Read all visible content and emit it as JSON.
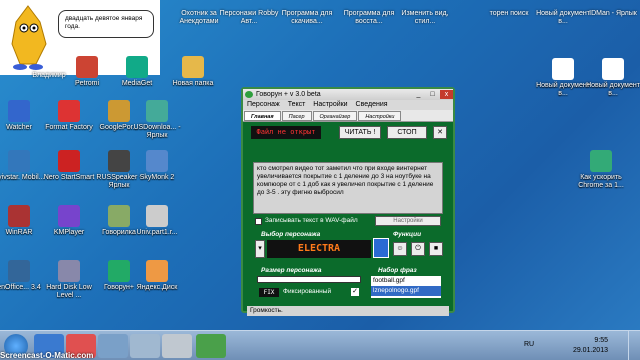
{
  "widget": {
    "bubble": "двадцать девятое января года.",
    "name_label": "Владимир"
  },
  "top_row": [
    "Охотник за Анекдотами",
    "Персонажи Robby Авт...",
    "Программа для скачива...",
    "Программа для восста...",
    "Изменить вид, стил...",
    "торен поиск",
    "Новый документ в...",
    "IDMan - Ярлык"
  ],
  "desktop_icons": [
    {
      "label": "Petromi"
    },
    {
      "label": "MediaGet"
    },
    {
      "label": "Новая папка"
    },
    {
      "label": "Watcher"
    },
    {
      "label": "Format Factory"
    },
    {
      "label": "GooglePor..."
    },
    {
      "label": "USDownloa... - Ярлык"
    },
    {
      "label": "Kyivstar. Mobil..."
    },
    {
      "label": "Nero StartSmart"
    },
    {
      "label": "RUSSpeaker - Ярлык"
    },
    {
      "label": "SkyMonk 2"
    },
    {
      "label": "WinRAR"
    },
    {
      "label": "KMPlayer"
    },
    {
      "label": "Говорилка"
    },
    {
      "label": "Univ.part1.r..."
    },
    {
      "label": "enOffice... 3.4"
    },
    {
      "label": "Hard Disk Low Level ..."
    },
    {
      "label": "Говорун+"
    },
    {
      "label": "Яндекс.Диск"
    },
    {
      "label": "Новый документ в..."
    },
    {
      "label": "Новый документ в..."
    },
    {
      "label": "Как ускорить Chrome за 1..."
    }
  ],
  "app": {
    "title": "Говорун + v 3.0 beta",
    "menu": [
      "Персонаж",
      "Текст",
      "Настройки",
      "Сведения"
    ],
    "tabs": [
      "Главная",
      "Пасер",
      "Органайзер",
      "Настройки"
    ],
    "file_status": "Файл не открыт",
    "read_btn": "ЧИТАТЬ !",
    "stop_btn": "СТОП",
    "close_btn": "✕",
    "text": "кто смотрел видео тот заметил что при входе винтернет увеличивается покрытие с 1 деление до 3 на ноутбуке на компюоре от с 1 доб как я увеличел покрытие с 1 деление до 3-5 . эту фигню выбросил",
    "wav_label": "Записывать текст в WAV-файл",
    "settings_btn": "Настройки",
    "char_select_label": "Выбор персонажа",
    "char_name": "ELECTRA",
    "functions_label": "Функции",
    "size_label": "Размер персонажа",
    "fix_btn": "FIX",
    "fixed_label": "Фиксированный",
    "phrases_label": "Набор фраз",
    "phrases": [
      "football.gpf",
      "lznepolnogo.gpf"
    ],
    "volume_label": "Громкость."
  },
  "taskbar": {
    "lang": "RU",
    "time": "9:55",
    "date": "29.01.2013"
  },
  "watermark": "Screencast-O-Matic.com"
}
